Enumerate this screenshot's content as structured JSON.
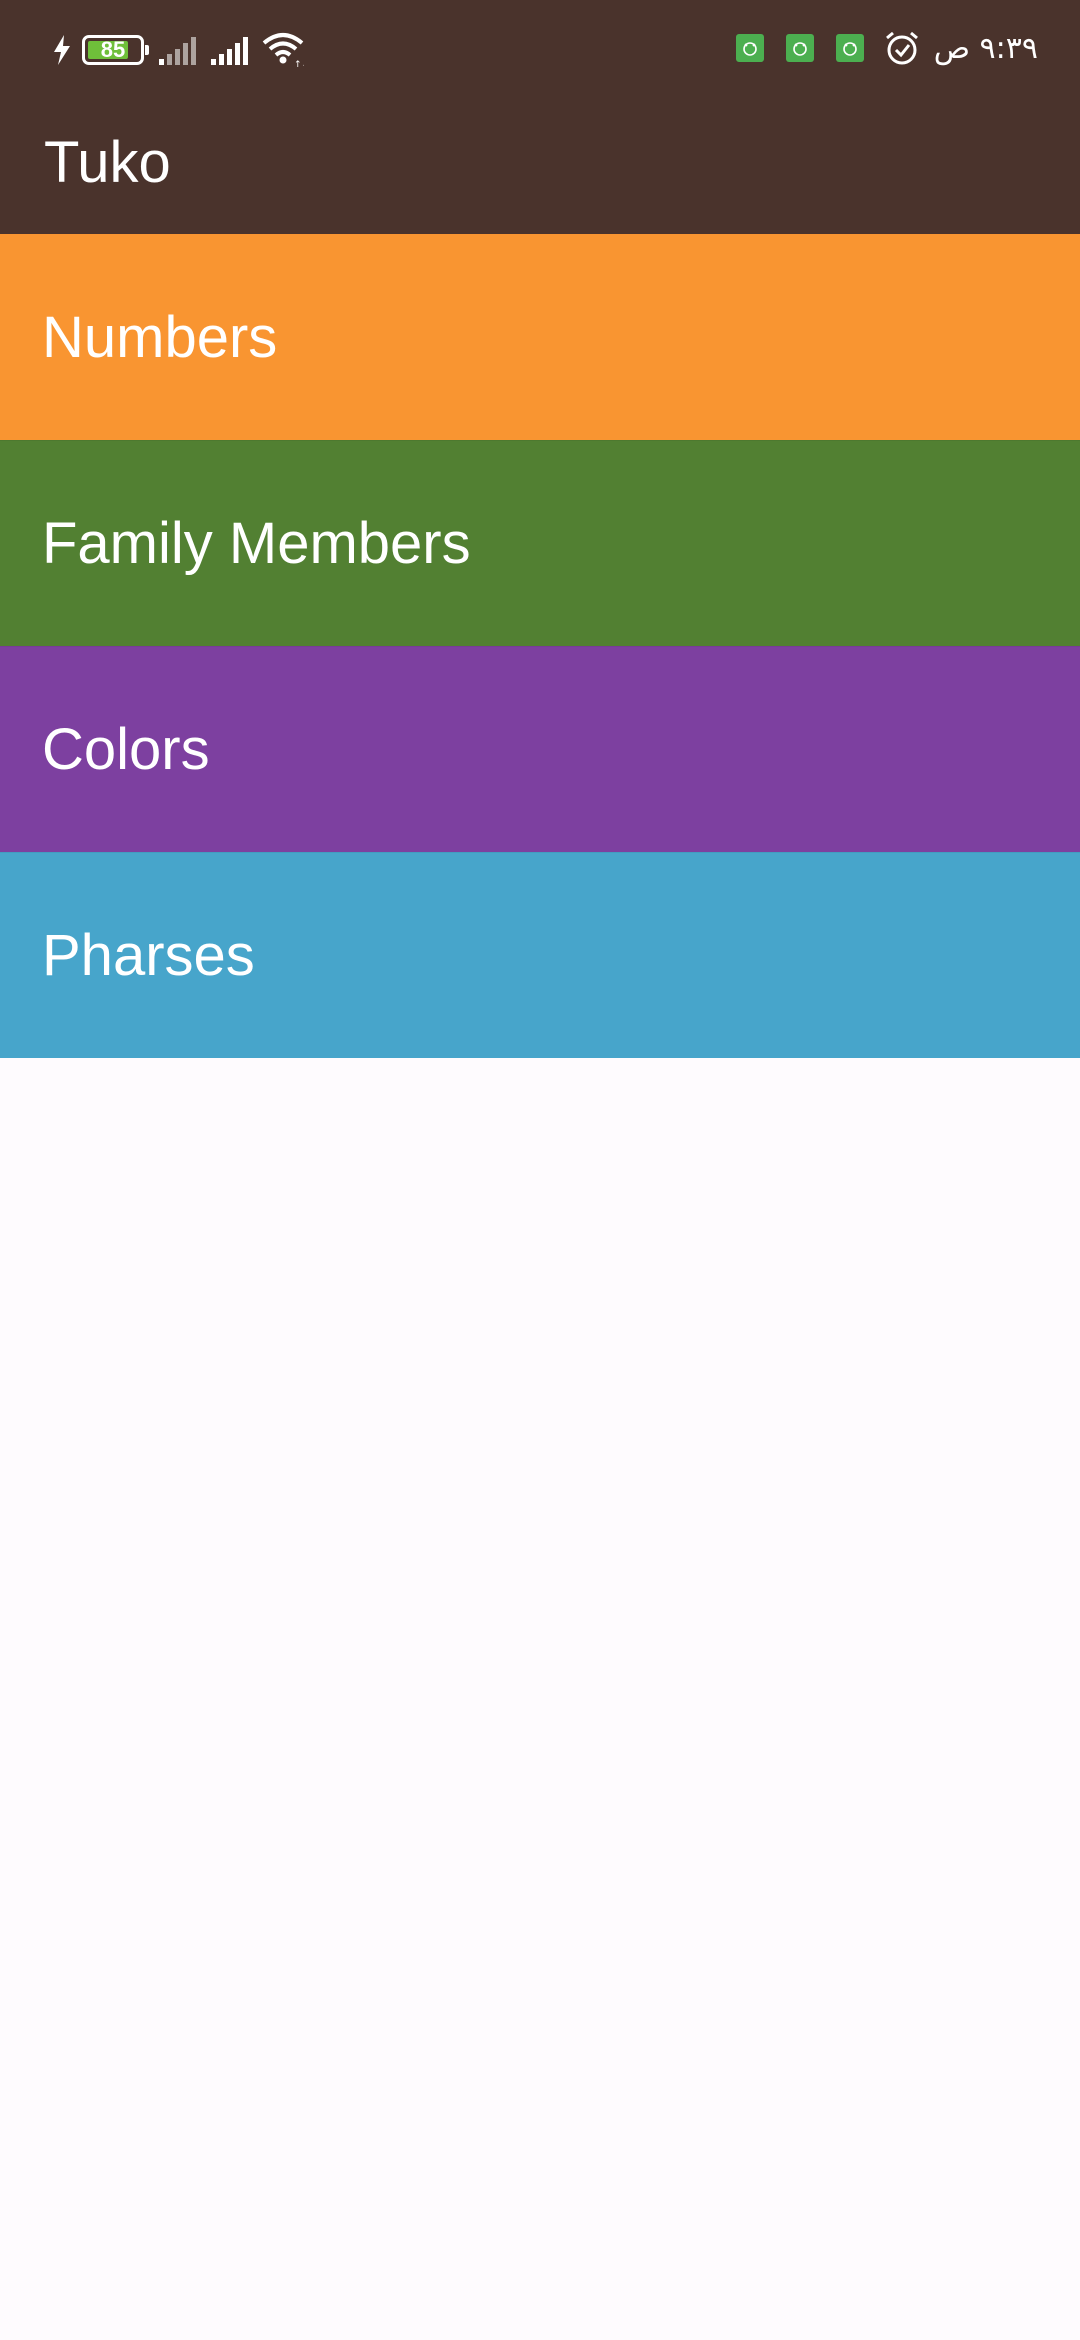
{
  "status_bar": {
    "battery_level": "85",
    "clock": "٩:٣٩ ص",
    "icons": [
      "charging-bolt-icon",
      "battery-icon",
      "signal-icon",
      "signal-icon",
      "wifi-icon",
      "app-notification-icon",
      "app-notification-icon",
      "app-notification-icon",
      "alarm-icon"
    ]
  },
  "app_bar": {
    "title": "Tuko",
    "background_color": "#4a332c"
  },
  "categories": [
    {
      "label": "Numbers",
      "color": "#f99531"
    },
    {
      "label": "Family Members",
      "color": "#528032"
    },
    {
      "label": "Colors",
      "color": "#7d40a0"
    },
    {
      "label": "Pharses",
      "color": "#47a5cb"
    }
  ],
  "page_background": "#fefbfe"
}
